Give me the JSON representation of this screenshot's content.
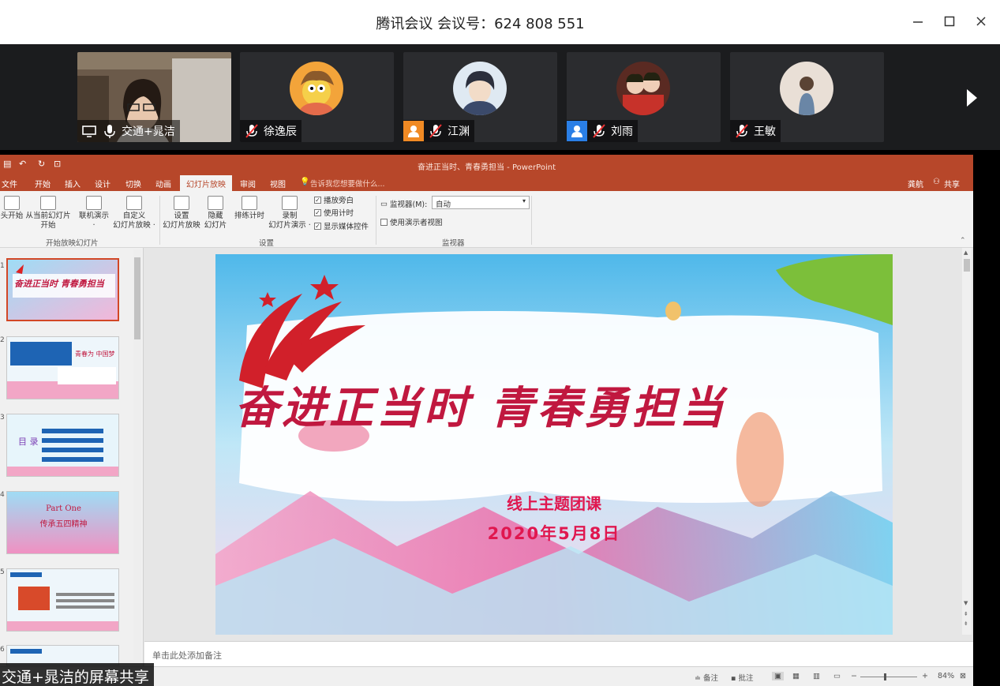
{
  "window": {
    "title": "腾讯会议 会议号：624 808 551",
    "minimize_icon": "minimize-icon",
    "maximize_icon": "maximize-icon",
    "close_icon": "close-icon"
  },
  "participants": [
    {
      "name": "交通+晁洁",
      "mic": "on",
      "has_video": true,
      "screen_share": true
    },
    {
      "name": "徐逸辰",
      "mic": "muted",
      "has_video": false
    },
    {
      "name": "江渊",
      "mic": "muted",
      "has_video": false,
      "badge": "person-icon",
      "badge_color": "#f08a24"
    },
    {
      "name": "刘雨",
      "mic": "muted",
      "has_video": false,
      "badge": "person-icon",
      "badge_color": "#2a7fe6"
    },
    {
      "name": "王敏",
      "mic": "muted",
      "has_video": false
    }
  ],
  "powerpoint": {
    "doc_title": "奋进正当时、青春勇担当 - PowerPoint",
    "account": "龚航",
    "share_label": "共享",
    "tell_me": "告诉我您想要做什么...",
    "tabs": [
      "文件",
      "开始",
      "插入",
      "设计",
      "切换",
      "动画",
      "幻灯片放映",
      "审阅",
      "视图"
    ],
    "active_tab": "幻灯片放映",
    "ribbon": {
      "from_start": "头开始",
      "from_current_line1": "从当前幻灯片",
      "from_current_line2": "开始",
      "online_line1": "联机演示",
      "online_line2": "·",
      "custom_line1": "自定义",
      "custom_line2": "幻灯片放映 ·",
      "group_start": "开始放映幻灯片",
      "setup_line1": "设置",
      "setup_line2": "幻灯片放映",
      "hide_line1": "隐藏",
      "hide_line2": "幻灯片",
      "rehearse": "排练计时",
      "record_line1": "录制",
      "record_line2": "幻灯片演示 ·",
      "chk_narration": "播放旁白",
      "chk_timing": "使用计时",
      "chk_media": "显示媒体控件",
      "group_setup": "设置",
      "monitor_label": "监视器(M):",
      "monitor_value": "自动",
      "presenter_view": "使用演示者视图",
      "group_monitor": "监视器"
    },
    "thumbnails": [
      {
        "num": "1",
        "text": "奋进正当时 青春勇担当",
        "selected": true
      },
      {
        "num": "2",
        "text": "青春为 中国梦",
        "selected": false
      },
      {
        "num": "3",
        "text": "目 录",
        "selected": false
      },
      {
        "num": "4",
        "text_line1": "Part One",
        "text_line2": "传承五四精神",
        "selected": false
      },
      {
        "num": "5",
        "text": "",
        "selected": false
      },
      {
        "num": "6",
        "text": "",
        "selected": false
      }
    ],
    "slide": {
      "headline": "奋进正当时 青春勇担当",
      "subtitle": "线上主题团课",
      "date": "2020年5月8日"
    },
    "notes_placeholder": "单击此处添加备注",
    "status": {
      "notes": "备注",
      "comments": "批注",
      "zoom": "84%"
    }
  },
  "share_banner": "交通+晁洁的屏幕共享",
  "colors": {
    "ppt_accent": "#b7472a",
    "slide_title": "#c0183f",
    "slide_sub": "#e0174f"
  }
}
